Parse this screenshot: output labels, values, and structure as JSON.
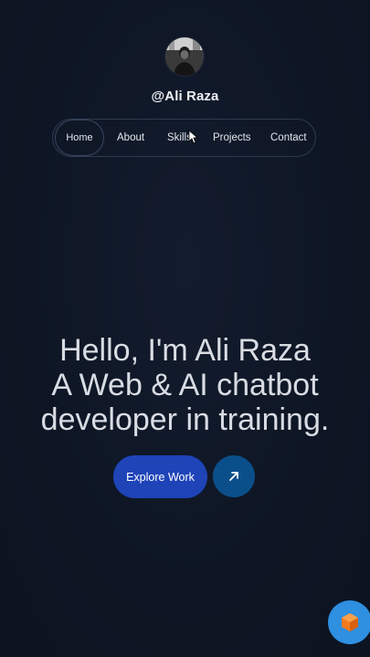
{
  "profile": {
    "handle": "@Ali Raza"
  },
  "nav": {
    "items": [
      {
        "label": "Home"
      },
      {
        "label": "About"
      },
      {
        "label": "Skills"
      },
      {
        "label": "Projects"
      },
      {
        "label": "Contact"
      }
    ],
    "active": "Home"
  },
  "hero": {
    "line1": "Hello, I'm Ali Raza",
    "line2": "A Web & AI chatbot",
    "line3": "developer in training."
  },
  "cta": {
    "explore_label": "Explore Work",
    "arrow_icon": "arrow-up-right-icon"
  },
  "colors": {
    "background": "#0f1726",
    "primary_button": "#1e44b8",
    "secondary_button": "#0b4f8a",
    "widget": "#2f8fe0",
    "widget_icon": "#f47a1f"
  },
  "widget": {
    "icon": "cube-icon"
  }
}
